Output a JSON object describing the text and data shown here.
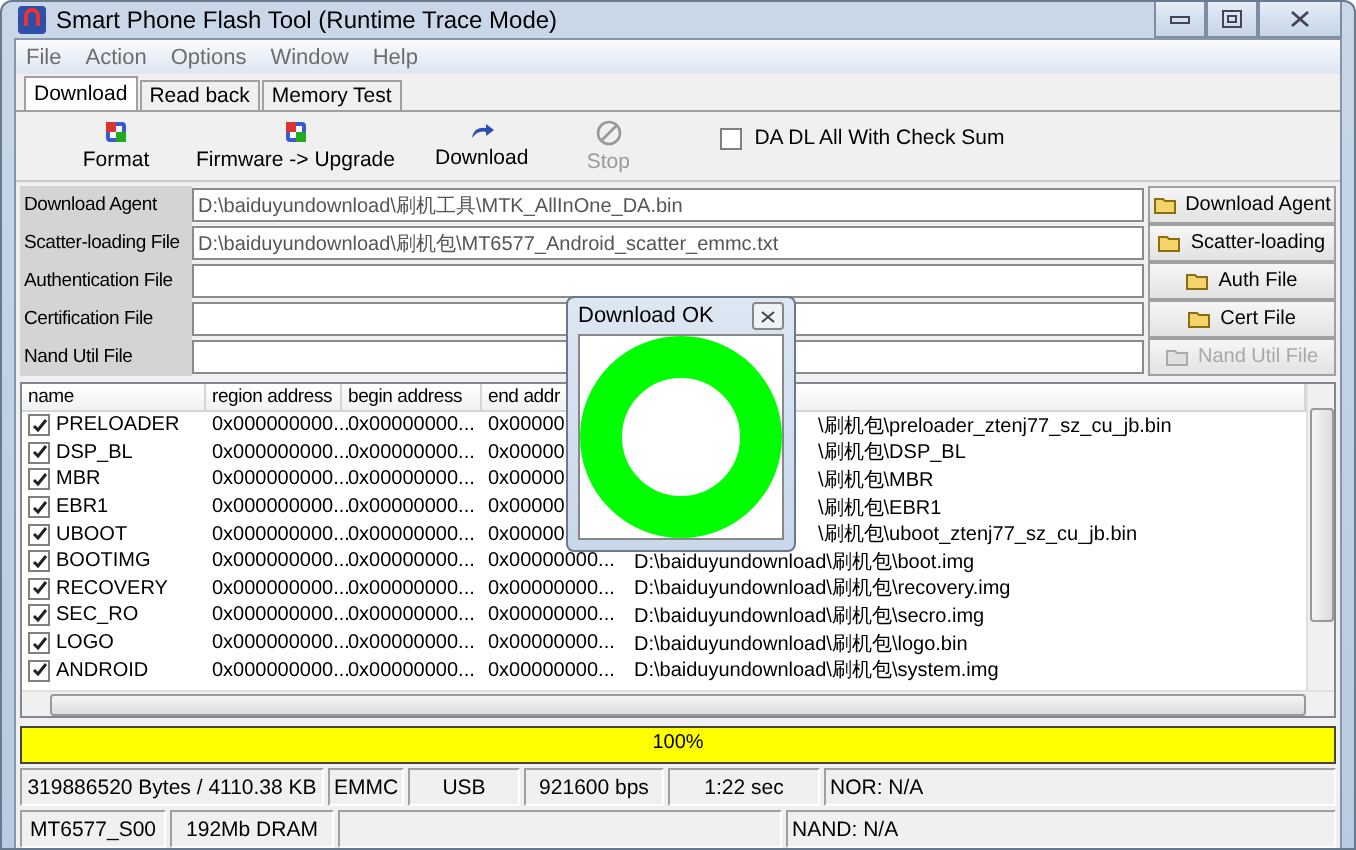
{
  "window": {
    "title": "Smart Phone Flash Tool (Runtime Trace Mode)"
  },
  "menu": [
    "File",
    "Action",
    "Options",
    "Window",
    "Help"
  ],
  "tabs": [
    {
      "label": "Download",
      "selected": true
    },
    {
      "label": "Read back",
      "selected": false
    },
    {
      "label": "Memory Test",
      "selected": false
    }
  ],
  "toolbar": [
    {
      "label": "Format",
      "kind": "format",
      "disabled": false
    },
    {
      "label": "Firmware -> Upgrade",
      "kind": "format",
      "disabled": false
    },
    {
      "label": "Download",
      "kind": "download",
      "disabled": false
    },
    {
      "label": "Stop",
      "kind": "stop",
      "disabled": true
    }
  ],
  "checksum": {
    "label": "DA DL All With Check Sum",
    "checked": false
  },
  "files": [
    {
      "label": "Download Agent",
      "value": "D:\\baiduyundownload\\刷机工具\\MTK_AllInOne_DA.bin",
      "button": "Download Agent",
      "disabled": false
    },
    {
      "label": "Scatter-loading File",
      "value": "D:\\baiduyundownload\\刷机包\\MT6577_Android_scatter_emmc.txt",
      "button": "Scatter-loading",
      "disabled": false
    },
    {
      "label": "Authentication File",
      "button": "Auth File",
      "disabled": false
    },
    {
      "label": "Certification File",
      "button": "Cert File",
      "disabled": false
    },
    {
      "label": "Nand Util File",
      "button": "Nand Util File",
      "disabled": true
    }
  ],
  "table": {
    "columns": [
      "name",
      "region address",
      "begin address",
      "end addr"
    ],
    "rows": [
      {
        "checked": true,
        "name": "PRELOADER",
        "region": "0x000000000...",
        "begin": "0x00000000...",
        "end": "0x00000",
        "path": "\\刷机包\\preloader_ztenj77_sz_cu_jb.bin",
        "clipped": true
      },
      {
        "checked": true,
        "name": "DSP_BL",
        "region": "0x000000000...",
        "begin": "0x00000000...",
        "end": "0x00000",
        "path": "\\刷机包\\DSP_BL",
        "clipped": true
      },
      {
        "checked": true,
        "name": "MBR",
        "region": "0x000000000...",
        "begin": "0x00000000...",
        "end": "0x00000",
        "path": "\\刷机包\\MBR",
        "clipped": true
      },
      {
        "checked": true,
        "name": "EBR1",
        "region": "0x000000000...",
        "begin": "0x00000000...",
        "end": "0x00000",
        "path": "\\刷机包\\EBR1",
        "clipped": true
      },
      {
        "checked": true,
        "name": "UBOOT",
        "region": "0x000000000...",
        "begin": "0x00000000...",
        "end": "0x00000",
        "path": "\\刷机包\\uboot_ztenj77_sz_cu_jb.bin",
        "clipped": true
      },
      {
        "checked": true,
        "name": "BOOTIMG",
        "region": "0x000000000...",
        "begin": "0x00000000...",
        "end": "0x00000000...",
        "path": "D:\\baiduyundownload\\刷机包\\boot.img",
        "clipped": false
      },
      {
        "checked": true,
        "name": "RECOVERY",
        "region": "0x000000000...",
        "begin": "0x00000000...",
        "end": "0x00000000...",
        "path": "D:\\baiduyundownload\\刷机包\\recovery.img",
        "clipped": false
      },
      {
        "checked": true,
        "name": "SEC_RO",
        "region": "0x000000000...",
        "begin": "0x00000000...",
        "end": "0x00000000...",
        "path": "D:\\baiduyundownload\\刷机包\\secro.img",
        "clipped": false
      },
      {
        "checked": true,
        "name": "LOGO",
        "region": "0x000000000...",
        "begin": "0x00000000...",
        "end": "0x00000000...",
        "path": "D:\\baiduyundownload\\刷机包\\logo.bin",
        "clipped": false
      },
      {
        "checked": true,
        "name": "ANDROID",
        "region": "0x000000000...",
        "begin": "0x00000000...",
        "end": "0x00000000...",
        "path": "D:\\baiduyundownload\\刷机包\\system.img",
        "clipped": false
      }
    ]
  },
  "progress": {
    "level": 1,
    "label": "100%"
  },
  "status_bar": [
    [
      "319886520 Bytes / 4110.38 KB",
      "EMMC",
      "USB",
      "921600 bps",
      "1:22 sec",
      "NOR: N/A"
    ],
    [
      "MT6577_S00",
      "192Mb DRAM",
      "NAND: N/A"
    ]
  ],
  "dialog": {
    "title": "Download OK"
  }
}
